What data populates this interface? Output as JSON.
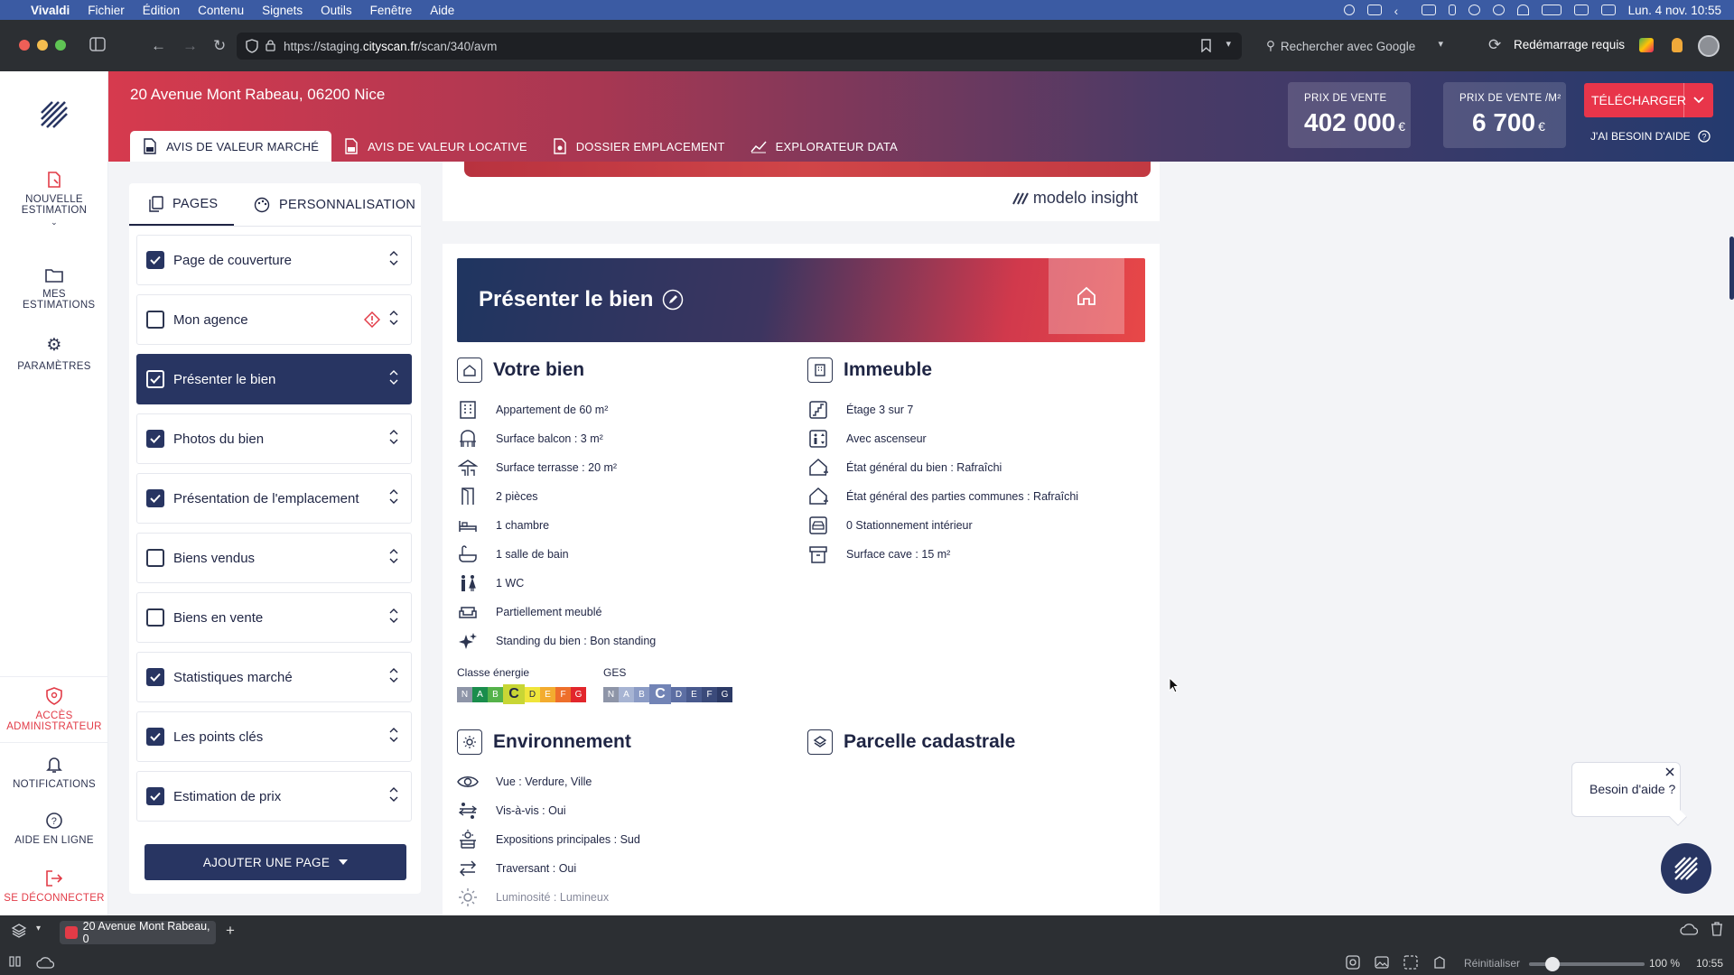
{
  "macos_menubar": {
    "app": "Vivaldi",
    "menus": [
      "Fichier",
      "Édition",
      "Contenu",
      "Signets",
      "Outils",
      "Fenêtre",
      "Aide"
    ],
    "clock": "Lun. 4 nov.  10:55"
  },
  "browser": {
    "url_prefix": "https://staging.",
    "url_domain": "cityscan.fr",
    "url_path": "/scan/340/avm",
    "search_placeholder": "Rechercher avec Google",
    "restart_label": "Redémarrage requis"
  },
  "app_sidebar": {
    "items": [
      {
        "label": "NOUVELLE ESTIMATION",
        "icon": "new-estimation-icon"
      },
      {
        "label": "MES ESTIMATIONS",
        "icon": "folder-icon"
      },
      {
        "label": "PARAMÈTRES",
        "icon": "gear-icon"
      }
    ],
    "bottom": [
      {
        "label": "ACCÈS ADMINISTRATEUR",
        "icon": "shield-icon"
      },
      {
        "label": "NOTIFICATIONS",
        "icon": "bell-icon"
      },
      {
        "label": "AIDE EN LIGNE",
        "icon": "help-icon"
      },
      {
        "label": "SE DÉCONNECTER",
        "icon": "logout-icon"
      }
    ]
  },
  "header": {
    "address": "20 Avenue Mont Rabeau, 06200 Nice",
    "tabs": [
      {
        "label": "AVIS DE VALEUR MARCHÉ",
        "active": true
      },
      {
        "label": "AVIS DE VALEUR LOCATIVE",
        "active": false
      },
      {
        "label": "DOSSIER EMPLACEMENT",
        "active": false
      },
      {
        "label": "EXPLORATEUR DATA",
        "active": false
      }
    ],
    "price_label": "PRIX DE VENTE",
    "price_value": "402 000",
    "price_m2_label": "PRIX DE VENTE /M²",
    "price_m2_value": "6 700",
    "currency": "€",
    "download_label": "TÉLÉCHARGER",
    "help_label": "J'AI BESOIN D'AIDE"
  },
  "pages_panel": {
    "tab_pages": "PAGES",
    "tab_custom": "PERSONNALISATION",
    "rows": [
      {
        "label": "Page de couverture",
        "checked": true
      },
      {
        "label": "Mon agence",
        "checked": false,
        "warning": true
      },
      {
        "label": "Présenter le bien",
        "checked": true,
        "selected": true
      },
      {
        "label": "Photos du bien",
        "checked": true
      },
      {
        "label": "Présentation de l'emplacement",
        "checked": true
      },
      {
        "label": "Biens vendus",
        "checked": false
      },
      {
        "label": "Biens en vente",
        "checked": false
      },
      {
        "label": "Statistiques marché",
        "checked": true
      },
      {
        "label": "Les points clés",
        "checked": true
      },
      {
        "label": "Estimation de prix",
        "checked": true
      }
    ],
    "add_page": "AJOUTER UNE PAGE"
  },
  "preview": {
    "brand": "modelo insight",
    "banner_title": "Présenter le bien",
    "votre_bien": {
      "title": "Votre bien",
      "items": [
        {
          "text": "Appartement de 60 m²",
          "icon": "building-icon"
        },
        {
          "text": "Surface balcon : 3 m²",
          "icon": "balcony-icon"
        },
        {
          "text": "Surface terrasse : 20 m²",
          "icon": "terrace-icon"
        },
        {
          "text": "2 pièces",
          "icon": "door-icon"
        },
        {
          "text": "1 chambre",
          "icon": "bed-icon"
        },
        {
          "text": "1 salle de bain",
          "icon": "bath-icon"
        },
        {
          "text": "1 WC",
          "icon": "wc-icon"
        },
        {
          "text": "Partiellement meublé",
          "icon": "sofa-icon"
        },
        {
          "text": "Standing du bien : Bon standing",
          "icon": "sparkle-icon"
        }
      ]
    },
    "immeuble": {
      "title": "Immeuble",
      "items": [
        {
          "text": "Étage 3 sur 7",
          "icon": "stairs-icon"
        },
        {
          "text": "Avec ascenseur",
          "icon": "elevator-icon"
        },
        {
          "text": "État général du bien : Rafraîchi",
          "icon": "house-state-icon"
        },
        {
          "text": "État général des parties communes : Rafraîchi",
          "icon": "house-state-icon"
        },
        {
          "text": "0 Stationnement intérieur",
          "icon": "car-icon"
        },
        {
          "text": "Surface cave : 15 m²",
          "icon": "archive-icon"
        }
      ]
    },
    "energy": {
      "label": "Classe énergie",
      "scale": [
        "N",
        "A",
        "B",
        "C",
        "D",
        "E",
        "F",
        "G"
      ],
      "active": "C",
      "colors": [
        "#8e95a8",
        "#1a8d4c",
        "#55b24a",
        "#c8d635",
        "#f0e53a",
        "#f3ac2f",
        "#ee6f2b",
        "#e2262c"
      ]
    },
    "ges": {
      "label": "GES",
      "scale": [
        "N",
        "A",
        "B",
        "C",
        "D",
        "E",
        "F",
        "G"
      ],
      "active": "C",
      "colors": [
        "#8e95a8",
        "#a7b4d3",
        "#8b9bc5",
        "#7284b6",
        "#5c6ea3",
        "#495a8e",
        "#3a4a7a",
        "#2c3a66"
      ]
    },
    "environnement": {
      "title": "Environnement",
      "items": [
        {
          "text": "Vue : Verdure, Ville",
          "icon": "eye-icon"
        },
        {
          "text": "Vis-à-vis : Oui",
          "icon": "vis-a-vis-icon"
        },
        {
          "text": "Expositions principales : Sud",
          "icon": "sun-exposure-icon"
        },
        {
          "text": "Traversant : Oui",
          "icon": "arrows-icon"
        },
        {
          "text": "Luminosité : Lumineux",
          "icon": "sun-icon"
        }
      ]
    },
    "parcelle_title": "Parcelle cadastrale"
  },
  "chat": {
    "text": "Besoin d'aide ?"
  },
  "bottom_bar": {
    "tab_title": "20 Avenue Mont Rabeau, 0",
    "reset": "Réinitialiser",
    "zoom": "100 %",
    "time": "10:55"
  }
}
